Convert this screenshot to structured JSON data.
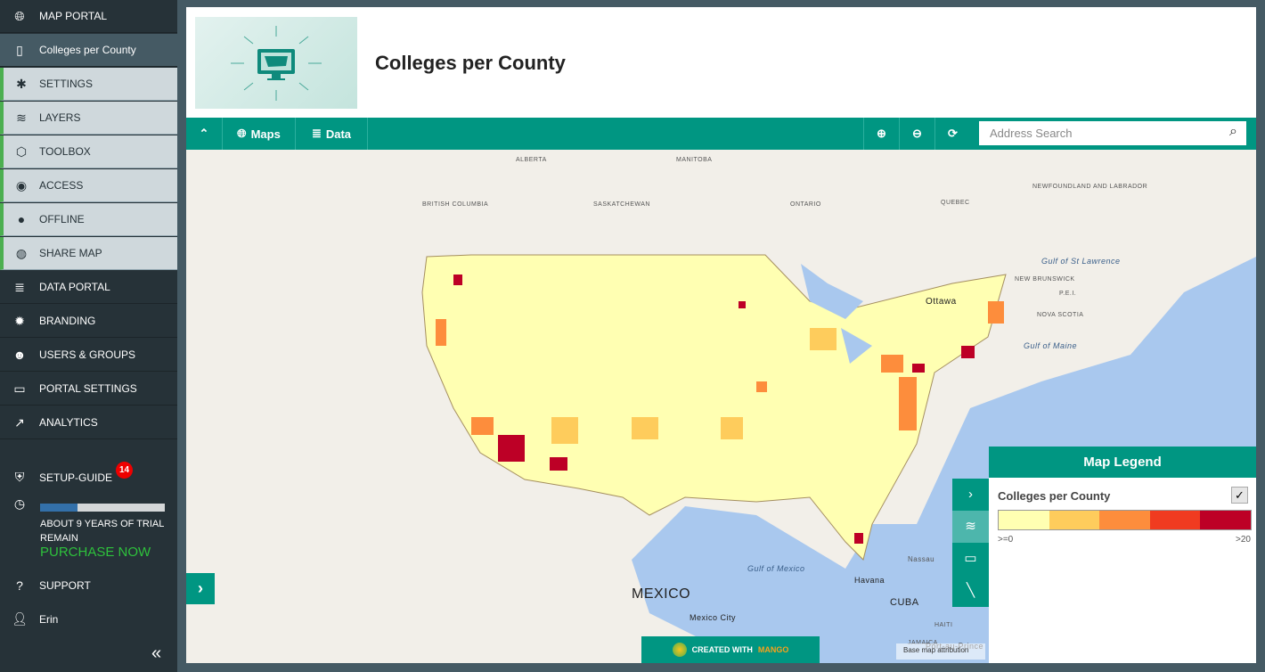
{
  "sidebar": {
    "items": [
      {
        "label": "MAP PORTAL",
        "icon": "globe-icon"
      },
      {
        "label": "Colleges per County",
        "icon": "map-panel-icon"
      },
      {
        "label": "SETTINGS",
        "icon": "gear-icon"
      },
      {
        "label": "LAYERS",
        "icon": "layers-icon"
      },
      {
        "label": "TOOLBOX",
        "icon": "box-icon"
      },
      {
        "label": "ACCESS",
        "icon": "eye-icon"
      },
      {
        "label": "OFFLINE",
        "icon": "toggle-icon"
      },
      {
        "label": "SHARE MAP",
        "icon": "share-globe-icon"
      },
      {
        "label": "DATA PORTAL",
        "icon": "database-icon"
      },
      {
        "label": "BRANDING",
        "icon": "badge-icon"
      },
      {
        "label": "USERS & GROUPS",
        "icon": "users-icon"
      },
      {
        "label": "PORTAL SETTINGS",
        "icon": "laptop-icon"
      },
      {
        "label": "ANALYTICS",
        "icon": "chart-icon"
      }
    ],
    "setup_guide": "SETUP-GUIDE",
    "setup_badge": "14",
    "trial_progress": 0.3,
    "trial_text": "ABOUT 9 YEARS OF TRIAL REMAIN",
    "purchase": "PURCHASE NOW",
    "support": "SUPPORT",
    "user": "Erin"
  },
  "header": {
    "title": "Colleges per County"
  },
  "toolbar": {
    "maps": "Maps",
    "data": "Data",
    "search_placeholder": "Address Search"
  },
  "map": {
    "labels": [
      "ALBERTA",
      "MANITOBA",
      "BRITISH COLUMBIA",
      "SASKATCHEWAN",
      "ONTARIO",
      "QUEBEC",
      "NEWFOUNDLAND AND LABRADOR",
      "Ottawa",
      "Gulf of St Lawrence",
      "NEW BRUNSWICK",
      "P.E.I.",
      "NOVA SCOTIA",
      "Gulf of Maine",
      "Gulf of Mexico",
      "MEXICO",
      "Mexico City",
      "Nassau",
      "Havana",
      "CUBA",
      "HAITI",
      "JAMAICA",
      "Port-au-Prince"
    ],
    "attribution": "Base map attribution",
    "credit_prefix": "CREATED WITH",
    "credit_brand": "MANGO"
  },
  "legend": {
    "header": "Map Legend",
    "layer": "Colleges per County",
    "checked": "✓",
    "colors": [
      "#ffffb2",
      "#fecc5c",
      "#fd8d3c",
      "#f03b20",
      "#bd0026"
    ],
    "min_label": ">=0",
    "max_label": ">20"
  }
}
